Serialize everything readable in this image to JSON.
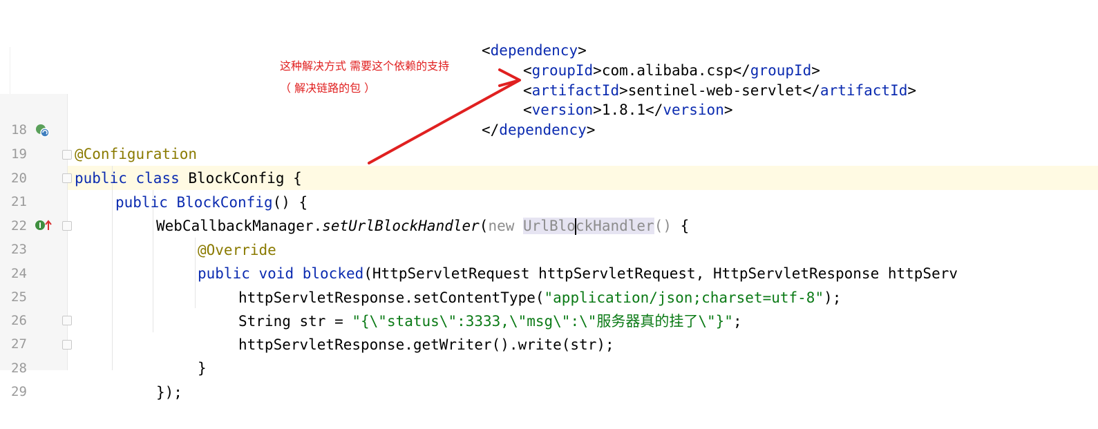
{
  "annotation": {
    "line1": "这种解决方式 需要这个依赖的支持",
    "line2": "（ 解决链路的包 ）",
    "arrow_color": "#e02020"
  },
  "xml": {
    "open_lt": "<",
    "dependency": "dependency",
    "gt": ">",
    "groupId": "groupId",
    "groupId_value": "com.alibaba.csp",
    "artifactId": "artifactId",
    "artifactId_value": "sentinel-web-servlet",
    "version": "version",
    "version_value": "1.8.1",
    "close_lt": "</"
  },
  "gutter": {
    "line_numbers": [
      "18",
      "19",
      "20",
      "21",
      "22",
      "23",
      "24",
      "25",
      "26",
      "27",
      "28",
      "29"
    ],
    "icons": {
      "line19": "spring-bean-icon",
      "line23": "implements-method-icon"
    }
  },
  "code": {
    "l18": {
      "annotation": "@Configuration"
    },
    "l19": {
      "kw1": "public",
      "kw2": "class",
      "name": "BlockConfig",
      "brace": " {"
    },
    "l20": {
      "kw": "public",
      "ctor": "BlockConfig",
      "rest": "() {"
    },
    "l21": {
      "obj": "WebCallbackManager.",
      "method": "setUrlBlockHandler",
      "paren": "(",
      "new_kw": "new ",
      "type_a": "UrlBlo",
      "type_b": "ckHandler",
      "rest1": "()",
      "rest2": " {"
    },
    "l22": {
      "annotation": "@Override"
    },
    "l23": {
      "kw1": "public",
      "kw2": "void",
      "method": "blocked",
      "params": "(HttpServletRequest httpServletRequest, HttpServletResponse httpServ"
    },
    "l24": {
      "pre": "httpServletResponse.setContentType(",
      "str": "\"application/json;charset=utf-8\"",
      "post": ");"
    },
    "l25": {
      "pre": "String str = ",
      "str": "\"{\\\"status\\\":3333,\\\"msg\\\":\\\"服务器真的挂了\\\"}\"",
      "post": ";"
    },
    "l26": {
      "text": "httpServletResponse.getWriter().write(str);"
    },
    "l27": {
      "text": "}"
    },
    "l28": {
      "text": "});"
    }
  }
}
